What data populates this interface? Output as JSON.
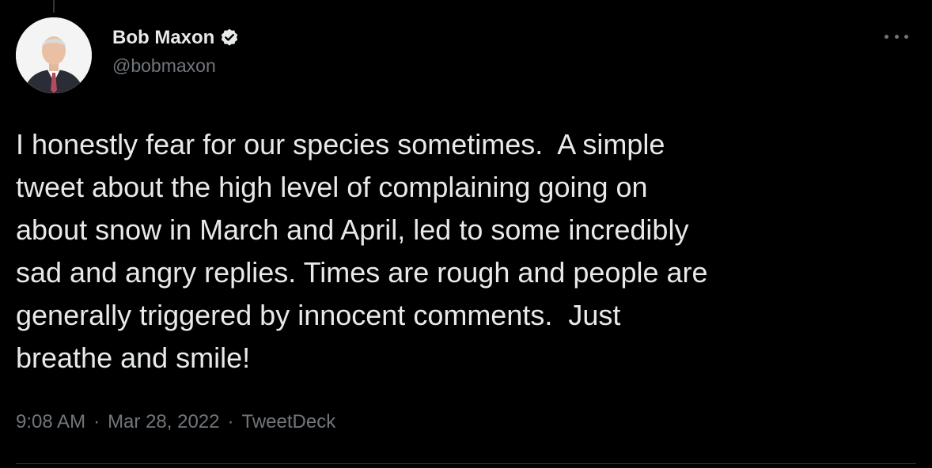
{
  "tweet": {
    "author": {
      "display_name": "Bob Maxon",
      "handle": "@bobmaxon",
      "verified": true
    },
    "text": "I honestly fear for our species sometimes.  A simple\ntweet about the high level of complaining going on\nabout snow in March and April, led to some incredibly\nsad and angry replies. Times are rough and people are\ngenerally triggered by innocent comments.  Just\nbreathe and smile!",
    "meta": {
      "time": "9:08 AM",
      "date": "Mar 28, 2022",
      "separator": "·",
      "source": "TweetDeck"
    }
  },
  "icons": {
    "verified": "verified-badge-icon",
    "more": "more-options-icon"
  },
  "colors": {
    "background": "#000000",
    "text_primary": "#e7e9ea",
    "text_secondary": "#71767b",
    "divider": "#2f3336"
  }
}
